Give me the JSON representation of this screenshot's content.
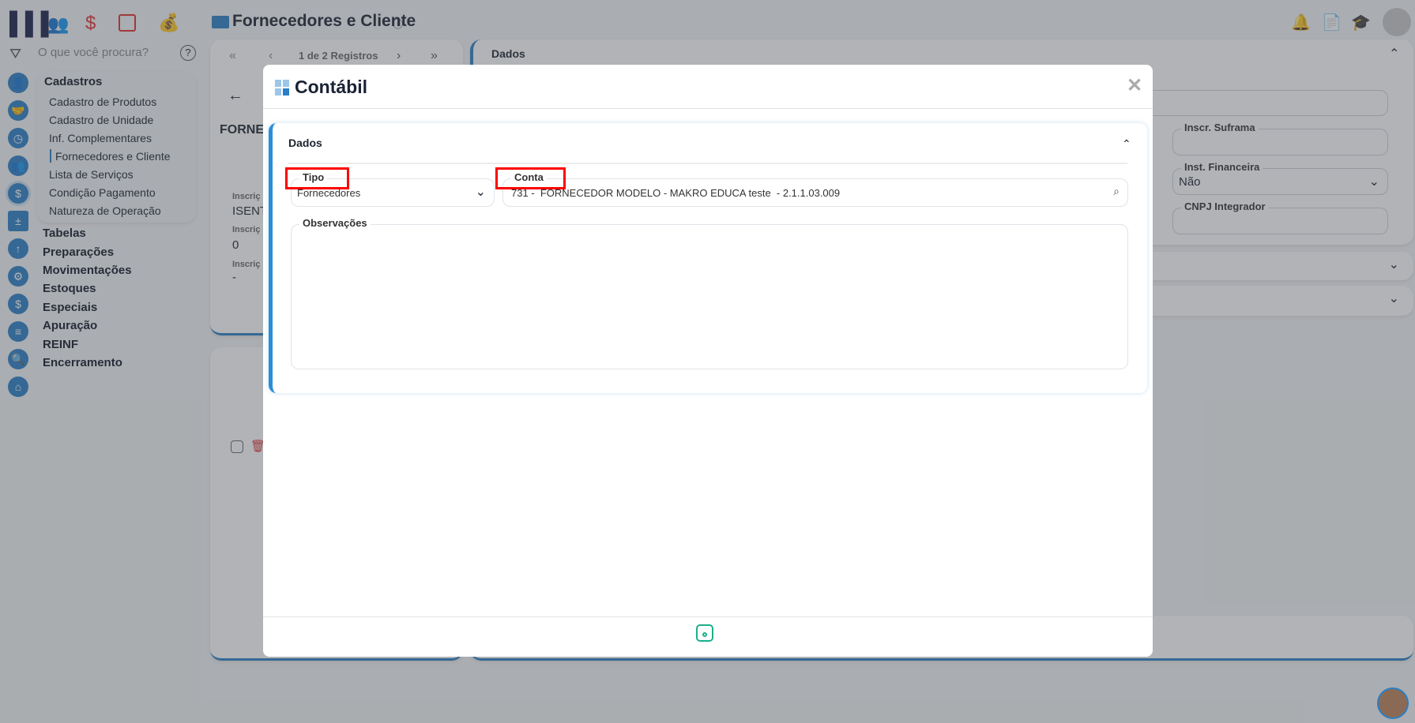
{
  "header": {
    "title": "Fornecedores e Cliente",
    "info_icon": "ⓘ"
  },
  "search": {
    "placeholder": "O que você procura?"
  },
  "menu": {
    "section": "Cadastros",
    "sub_items": [
      "Cadastro de Produtos",
      "Cadastro de Unidade",
      "Inf. Complementares",
      "Fornecedores e Cliente",
      "Lista de Serviços",
      "Condição Pagamento",
      "Natureza de Operação"
    ],
    "active": "Fornecedores e Cliente",
    "main_items": [
      "Tabelas",
      "Preparações",
      "Movimentações",
      "Estoques",
      "Especiais",
      "Apuração",
      "REINF",
      "Encerramento"
    ]
  },
  "left_card": {
    "pager": "1 de 2 Registros",
    "name_partial": "FORNEC",
    "fields": [
      {
        "label": "Inscriç",
        "value": "ISENTO"
      },
      {
        "label": "Inscriç",
        "value": "0"
      },
      {
        "label": "Inscriç",
        "value": "-"
      }
    ]
  },
  "right_card": {
    "section_title": "Dados",
    "fields": [
      {
        "label": "Inscr. Suframa",
        "value": ""
      },
      {
        "label": "Inst. Financeira",
        "value": "Não"
      },
      {
        "label": "CNPJ Integrador",
        "value": ""
      }
    ]
  },
  "modal": {
    "title": "Contábil",
    "section_title": "Dados",
    "tipo": {
      "label": "Tipo",
      "value": "Fornecedores"
    },
    "conta": {
      "label": "Conta",
      "value": "731 -  FORNECEDOR MODELO - MAKRO EDUCA teste  - 2.1.1.03.009"
    },
    "observacoes": {
      "label": "Observações",
      "value": ""
    }
  }
}
